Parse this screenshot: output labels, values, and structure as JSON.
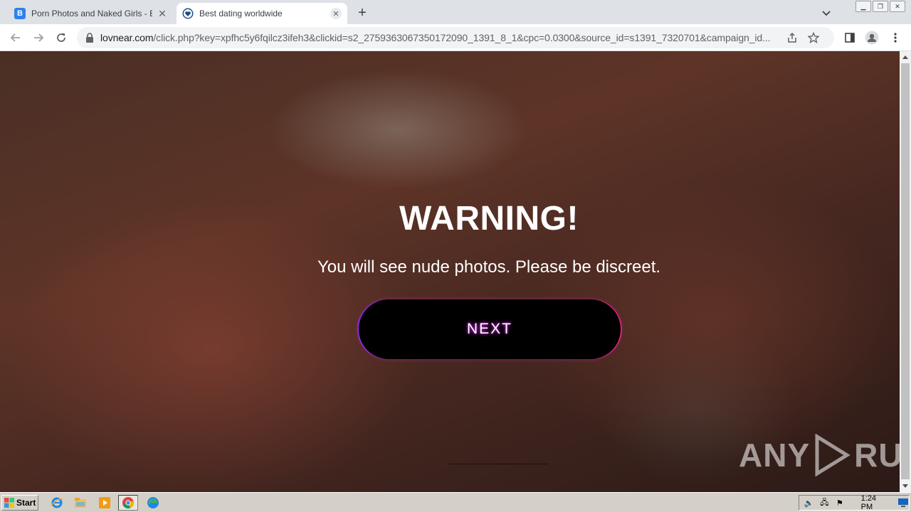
{
  "browser": {
    "tabs": [
      {
        "title": "Porn Photos and Naked Girls - Boomb",
        "favicon": "B",
        "active": false
      },
      {
        "title": "Best dating worldwide",
        "favicon": "heart-icon",
        "active": true
      }
    ],
    "url_host": "lovnear.com",
    "url_path": "/click.php?key=xpfhc5y6fqilcz3ifeh3&clickid=s2_2759363067350172090_1391_8_1&cpc=0.0300&source_id=s1391_7320701&campaign_id..."
  },
  "page": {
    "title": "WARNING!",
    "subtitle": "You will see nude photos. Please be discreet.",
    "next_label": "NEXT",
    "watermark": "ANY RUN"
  },
  "taskbar": {
    "start_label": "Start",
    "clock": "1:24 PM"
  },
  "colors": {
    "button_glow": "#c21fd4",
    "button_border_left": "#8a2be2",
    "button_border_right": "#d4237a"
  }
}
